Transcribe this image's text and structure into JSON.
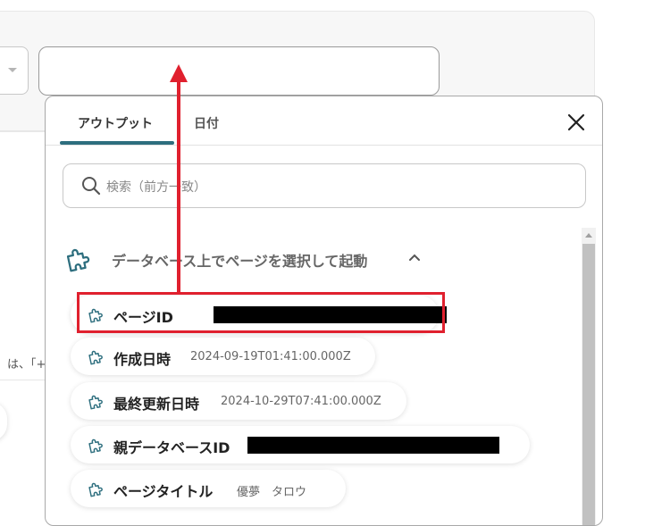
{
  "tabs": [
    {
      "label": "アウトプット",
      "active": true
    },
    {
      "label": "日付",
      "active": false
    }
  ],
  "search": {
    "placeholder": "検索（前方一致）"
  },
  "section": {
    "title": "データベース上でページを選択して起動"
  },
  "items": [
    {
      "label": "ページID",
      "value": ""
    },
    {
      "label": "作成日時",
      "value": "2024-09-19T01:41:00.000Z"
    },
    {
      "label": "最終更新日時",
      "value": "2024-10-29T07:41:00.000Z"
    },
    {
      "label": "親データベースID",
      "value": ""
    },
    {
      "label": "ページタイトル",
      "value": "優夢　タロウ"
    }
  ],
  "background": {
    "partial_text": "は、「+"
  },
  "colors": {
    "accent": "#2d6e7e",
    "annotation": "#e0202e"
  },
  "icons": {
    "close": "close-icon",
    "search": "search-icon",
    "item": "puzzle-icon",
    "collapse": "chevron-up-icon"
  }
}
